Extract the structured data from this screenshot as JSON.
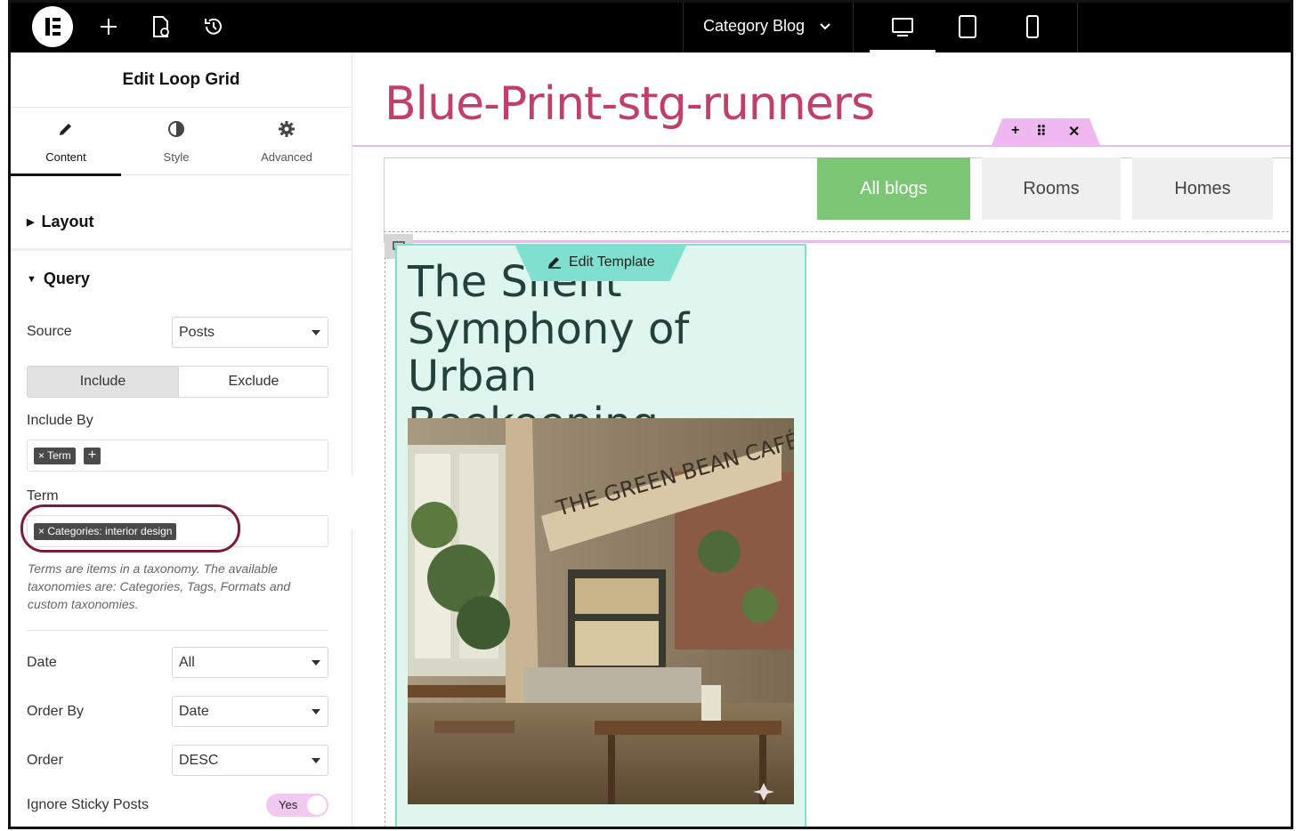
{
  "topbar": {
    "page_select_label": "Category Blog"
  },
  "panel": {
    "title": "Edit Loop Grid",
    "tabs": [
      {
        "label": "Content"
      },
      {
        "label": "Style"
      },
      {
        "label": "Advanced"
      }
    ],
    "sections": {
      "layout": "Layout",
      "query": "Query"
    },
    "source": {
      "label": "Source",
      "value": "Posts"
    },
    "include_exclude": {
      "include": "Include",
      "exclude": "Exclude",
      "selected": "Include"
    },
    "include_by": {
      "label": "Include By",
      "tag": "Term"
    },
    "term": {
      "label": "Term",
      "tag": "Categories: interior design"
    },
    "help_text": "Terms are items in a taxonomy. The available taxonomies are: Categories, Tags, Formats and custom taxonomies.",
    "date": {
      "label": "Date",
      "value": "All"
    },
    "order_by": {
      "label": "Order By",
      "value": "Date"
    },
    "order": {
      "label": "Order",
      "value": "DESC"
    },
    "ignore_sticky": {
      "label": "Ignore Sticky Posts",
      "value": "Yes"
    }
  },
  "canvas": {
    "site_title": "Blue-Print-stg-runners",
    "filters": [
      {
        "label": "All blogs",
        "active": true
      },
      {
        "label": "Rooms",
        "active": false
      },
      {
        "label": "Homes",
        "active": false
      }
    ],
    "edit_template_label": "Edit Template",
    "post": {
      "title": "The Silent Symphony of Urban Beekeeping",
      "image_sign_text": "THE GREEN BEAN CAFÉ"
    }
  },
  "colors": {
    "site_title": "#c0406a",
    "filter_active": "#7cc676",
    "card_bg": "#dff6ef",
    "template_accent": "#7fe0d0",
    "widget_outline": "#e8b8f0",
    "highlight_ring": "#7a1c3c"
  }
}
